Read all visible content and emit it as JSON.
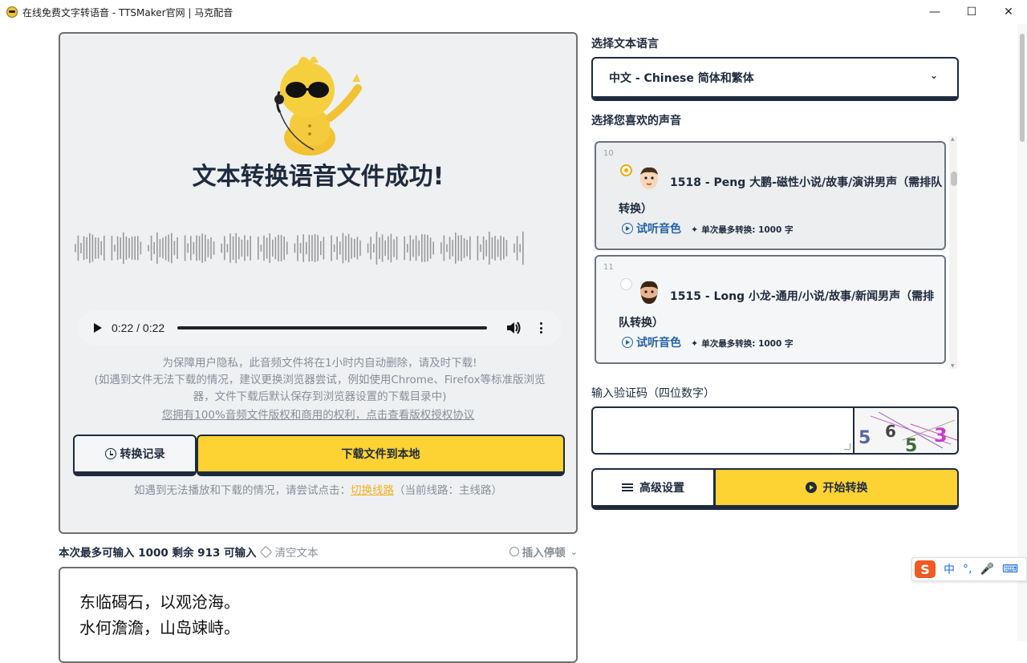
{
  "window": {
    "title": "在线免费文字转语音 - TTSMaker官网 | 马克配音",
    "minimize": "—",
    "maximize": "☐",
    "close": "✕"
  },
  "result": {
    "title": "文本转换语音文件成功!",
    "audio_time": "0:22 / 0:22",
    "notice_line1": "为保障用户隐私，此音频文件将在1小时内自动删除，请及时下载!",
    "notice_line2": "(如遇到文件无法下载的情况，建议更换浏览器尝试，例如使用Chrome、Firefox等标准版浏览器，文件下载后默认保存到浏览器设置的下载目录中)",
    "license_link": "您拥有100%音频文件版权和商用的权利，点击查看版权授权协议",
    "history_button": "转换记录",
    "download_button": "下载文件到本地",
    "switch_prefix": "如遇到无法播放和下载的情况，请尝试点击：",
    "switch_link": "切换线路",
    "switch_suffix": "（当前线路：主线路）"
  },
  "input": {
    "count_text": "本次最多可输入 1000 剩余 913 可输入",
    "clear_text": "清空文本",
    "insert_pause": "插入停顿",
    "text_line1": "东临碣石，以观沧海。",
    "text_line2": "水何澹澹，山岛竦峙。"
  },
  "language": {
    "label": "选择文本语言",
    "selected": "中文 - Chinese 简体和繁体"
  },
  "voices": {
    "label": "选择您喜欢的声音",
    "items": [
      {
        "num": "10",
        "name": "1518 - Peng 大鹏-磁性小说/故事/演讲男声（需排队转换）",
        "listen": "试听音色",
        "limit": "单次最多转换: 1000 字",
        "selected": true
      },
      {
        "num": "11",
        "name": "1515 - Long 小龙-通用/小说/故事/新闻男声（需排队转换）",
        "listen": "试听音色",
        "limit": "单次最多转换: 1000 字",
        "selected": false
      }
    ]
  },
  "captcha": {
    "label": "输入验证码（四位数字）",
    "chars": [
      "5",
      "6",
      "5",
      "3"
    ]
  },
  "actions": {
    "advanced": "高级设置",
    "start": "开始转换"
  },
  "ime": {
    "logo": "S",
    "lang": "中",
    "punct": "°,",
    "voice": "🎤",
    "keyboard": "⌨"
  },
  "colors": {
    "accent_yellow": "#fdd233",
    "navy": "#1e2a3e",
    "link_blue": "#2563a8",
    "link_orange": "#f2b01e"
  }
}
